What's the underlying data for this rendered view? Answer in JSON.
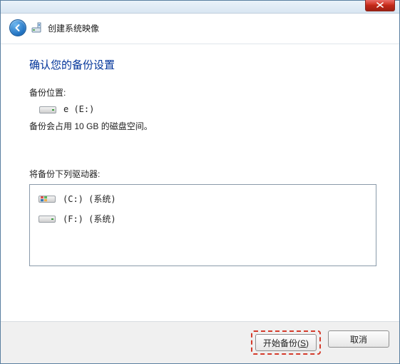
{
  "window": {
    "title": "创建系统映像"
  },
  "heading": "确认您的备份设置",
  "backup_location": {
    "label": "备份位置:",
    "value": "e (E:)",
    "note": "备份会占用 10 GB 的磁盘空间。"
  },
  "drives_section": {
    "label": "将备份下列驱动器:",
    "items": [
      {
        "label": "(C:) (系统)",
        "icon": "windows-drive"
      },
      {
        "label": "(F:) (系统)",
        "icon": "drive"
      }
    ]
  },
  "buttons": {
    "start_prefix": "开始备份(",
    "start_key": "S",
    "start_suffix": ")",
    "cancel": "取消"
  }
}
